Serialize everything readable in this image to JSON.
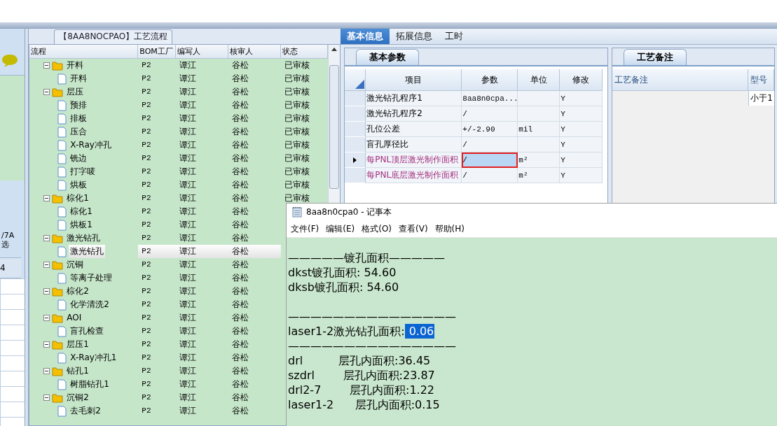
{
  "left_strip": {
    "texts": [
      "/7A",
      "选"
    ],
    "cell": "4"
  },
  "process_panel": {
    "title": "【8AA8NOCPAO】工艺流程",
    "columns": [
      "流程",
      "BOM工厂",
      "编写人",
      "核审人",
      "状态"
    ],
    "tree": [
      {
        "label": "开料",
        "bom": "P2",
        "writer": "谭江",
        "reviewer": "谷松",
        "status": "已审核",
        "expanded": true,
        "selected": false,
        "children": [
          {
            "label": "开料",
            "bom": "P2",
            "writer": "谭江",
            "reviewer": "谷松",
            "status": "已审核",
            "selected": false
          }
        ]
      },
      {
        "label": "层压",
        "bom": "P2",
        "writer": "谭江",
        "reviewer": "谷松",
        "status": "已审核",
        "expanded": true,
        "selected": false,
        "children": [
          {
            "label": "预排",
            "bom": "P2",
            "writer": "谭江",
            "reviewer": "谷松",
            "status": "已审核",
            "selected": false
          },
          {
            "label": "排板",
            "bom": "P2",
            "writer": "谭江",
            "reviewer": "谷松",
            "status": "已审核",
            "selected": false
          },
          {
            "label": "压合",
            "bom": "P2",
            "writer": "谭江",
            "reviewer": "谷松",
            "status": "已审核",
            "selected": false
          },
          {
            "label": "X-Ray冲孔",
            "bom": "P2",
            "writer": "谭江",
            "reviewer": "谷松",
            "status": "已审核",
            "selected": false
          },
          {
            "label": "铣边",
            "bom": "P2",
            "writer": "谭江",
            "reviewer": "谷松",
            "status": "已审核",
            "selected": false
          },
          {
            "label": "打字唛",
            "bom": "P2",
            "writer": "谭江",
            "reviewer": "谷松",
            "status": "已审核",
            "selected": false
          },
          {
            "label": "烘板",
            "bom": "P2",
            "writer": "谭江",
            "reviewer": "谷松",
            "status": "已审核",
            "selected": false
          }
        ]
      },
      {
        "label": "棕化1",
        "bom": "P2",
        "writer": "谭江",
        "reviewer": "谷松",
        "status": "已审核",
        "expanded": true,
        "selected": false,
        "children": [
          {
            "label": "棕化1",
            "bom": "P2",
            "writer": "谭江",
            "reviewer": "谷松",
            "selected": false
          },
          {
            "label": "烘板1",
            "bom": "P2",
            "writer": "谭江",
            "reviewer": "谷松",
            "selected": false
          }
        ]
      },
      {
        "label": "激光钻孔",
        "bom": "P2",
        "writer": "谭江",
        "reviewer": "谷松",
        "expanded": true,
        "selected": false,
        "children": [
          {
            "label": "激光钻孔",
            "bom": "P2",
            "writer": "谭江",
            "reviewer": "谷松",
            "selected": true
          }
        ]
      },
      {
        "label": "沉铜",
        "bom": "P2",
        "writer": "谭江",
        "reviewer": "谷松",
        "expanded": true,
        "selected": false,
        "children": [
          {
            "label": "等离子处理",
            "bom": "P2",
            "writer": "谭江",
            "reviewer": "谷松",
            "selected": false
          }
        ]
      },
      {
        "label": "棕化2",
        "bom": "P2",
        "writer": "谭江",
        "reviewer": "谷松",
        "expanded": true,
        "selected": false,
        "children": [
          {
            "label": "化学清洗2",
            "bom": "P2",
            "writer": "谭江",
            "reviewer": "谷松",
            "selected": false
          }
        ]
      },
      {
        "label": "AOI",
        "bom": "P2",
        "writer": "谭江",
        "reviewer": "谷松",
        "expanded": true,
        "selected": false,
        "children": [
          {
            "label": "盲孔检查",
            "bom": "P2",
            "writer": "谭江",
            "reviewer": "谷松",
            "selected": false
          }
        ]
      },
      {
        "label": "层压1",
        "bom": "P2",
        "writer": "谭江",
        "reviewer": "谷松",
        "expanded": true,
        "selected": false,
        "children": [
          {
            "label": "X-Ray冲孔1",
            "bom": "P2",
            "writer": "谭江",
            "reviewer": "谷松",
            "selected": false
          }
        ]
      },
      {
        "label": "钻孔1",
        "bom": "P2",
        "writer": "谭江",
        "reviewer": "谷松",
        "expanded": true,
        "selected": false,
        "children": [
          {
            "label": "树脂钻孔1",
            "bom": "P2",
            "writer": "谭江",
            "reviewer": "谷松",
            "selected": false
          }
        ]
      },
      {
        "label": "沉铜2",
        "bom": "P2",
        "writer": "谭江",
        "reviewer": "谷松",
        "expanded": true,
        "selected": false,
        "children": [
          {
            "label": "去毛刺2",
            "bom": "P2",
            "writer": "谭江",
            "reviewer": "谷松",
            "selected": false
          }
        ]
      }
    ]
  },
  "detail_panel": {
    "tabs": [
      {
        "label": "基本信息",
        "selected": true
      },
      {
        "label": "拓展信息",
        "selected": false
      },
      {
        "label": "工时",
        "selected": false
      }
    ],
    "params": {
      "tab": "基本参数",
      "columns": [
        "项目",
        "参数",
        "单位",
        "修改"
      ],
      "rows": [
        {
          "item": "激光钻孔程序1",
          "param": "8aa8n0cpa...",
          "unit": "",
          "modify": "Y",
          "selected": false
        },
        {
          "item": "激光钻孔程序2",
          "param": "/",
          "unit": "",
          "modify": "Y",
          "selected": false
        },
        {
          "item": "孔位公差",
          "param": "+/-2.90",
          "unit": "mil",
          "modify": "Y",
          "selected": false
        },
        {
          "item": "盲孔厚径比",
          "param": "/",
          "unit": "",
          "modify": "Y",
          "selected": false
        },
        {
          "item": "每PNL顶层激光制作面积",
          "param": "/",
          "unit": "m²",
          "modify": "Y",
          "selected": true,
          "color": "#a3307e"
        },
        {
          "item": "每PNL底层激光制作面积",
          "param": "/",
          "unit": "m²",
          "modify": "Y",
          "selected": false,
          "color": "#a3307e"
        }
      ]
    },
    "notes": {
      "tab": "工艺备注",
      "columns": [
        "工艺备注",
        "型号"
      ],
      "cell": "小于1"
    }
  },
  "notepad": {
    "title": "8aa8n0cpa0 - 记事本",
    "menu": [
      "文件(F)",
      "编辑(E)",
      "格式(O)",
      "查看(V)",
      "帮助(H)"
    ],
    "paragraphs": [
      [
        {
          "text": "—————镀孔面积—————"
        },
        {
          "text": "dkst镀孔面积: 54.60"
        },
        {
          "text": "dksb镀孔面积: 54.60"
        }
      ],
      [
        {
          "text": "———————————————"
        },
        {
          "text": "laser1-2激光钻孔面积:",
          "selected_text": "0.06"
        },
        {
          "text": "———————————————"
        },
        {
          "text": "drl          层孔内面积:36.45"
        },
        {
          "text": "szdrl        层孔内面积:23.87"
        },
        {
          "text": "drl2-7        层孔内面积:1.22"
        },
        {
          "text": "laser1-2      层孔内面积:0.15"
        }
      ]
    ]
  }
}
